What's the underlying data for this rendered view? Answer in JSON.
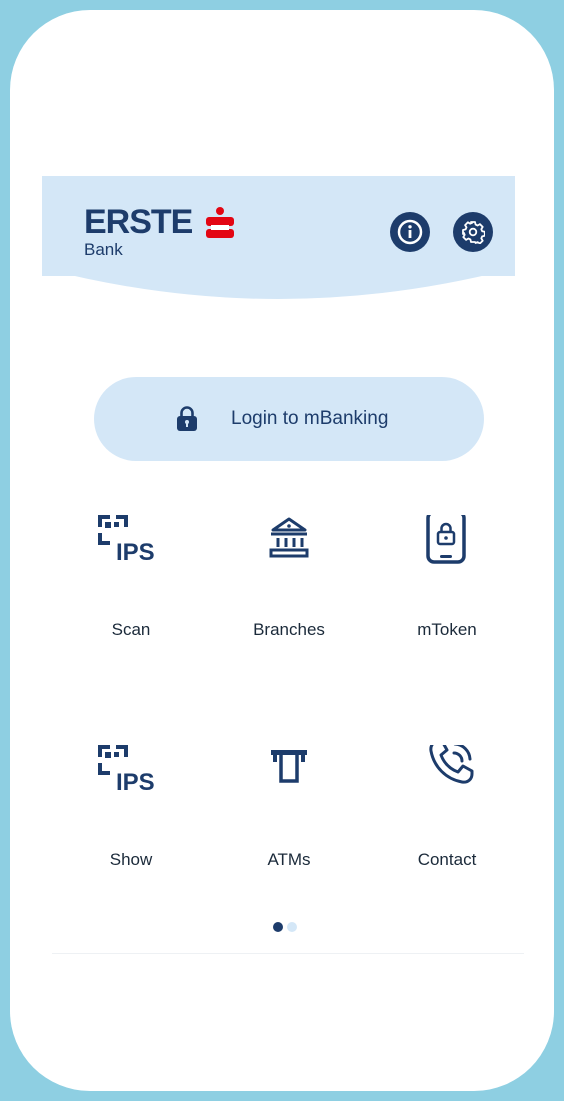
{
  "header": {
    "brand": "ERSTE",
    "brand_sub": "Bank",
    "info_icon": "info-icon",
    "settings_icon": "gear-icon"
  },
  "login": {
    "label": "Login to mBanking",
    "icon": "lock-icon"
  },
  "tiles": [
    {
      "label": "Scan",
      "icon": "ips-scan-icon"
    },
    {
      "label": "Branches",
      "icon": "bank-building-icon"
    },
    {
      "label": "mToken",
      "icon": "phone-lock-icon"
    },
    {
      "label": "Show",
      "icon": "ips-show-icon"
    },
    {
      "label": "ATMs",
      "icon": "atm-icon"
    },
    {
      "label": "Contact",
      "icon": "phone-call-icon"
    }
  ],
  "pager": {
    "pages": 2,
    "current": 1
  },
  "colors": {
    "primary": "#1d3c6b",
    "header_bg": "#d4e7f7",
    "brand_red": "#e30613",
    "frame_bg": "#8ecfe2"
  }
}
